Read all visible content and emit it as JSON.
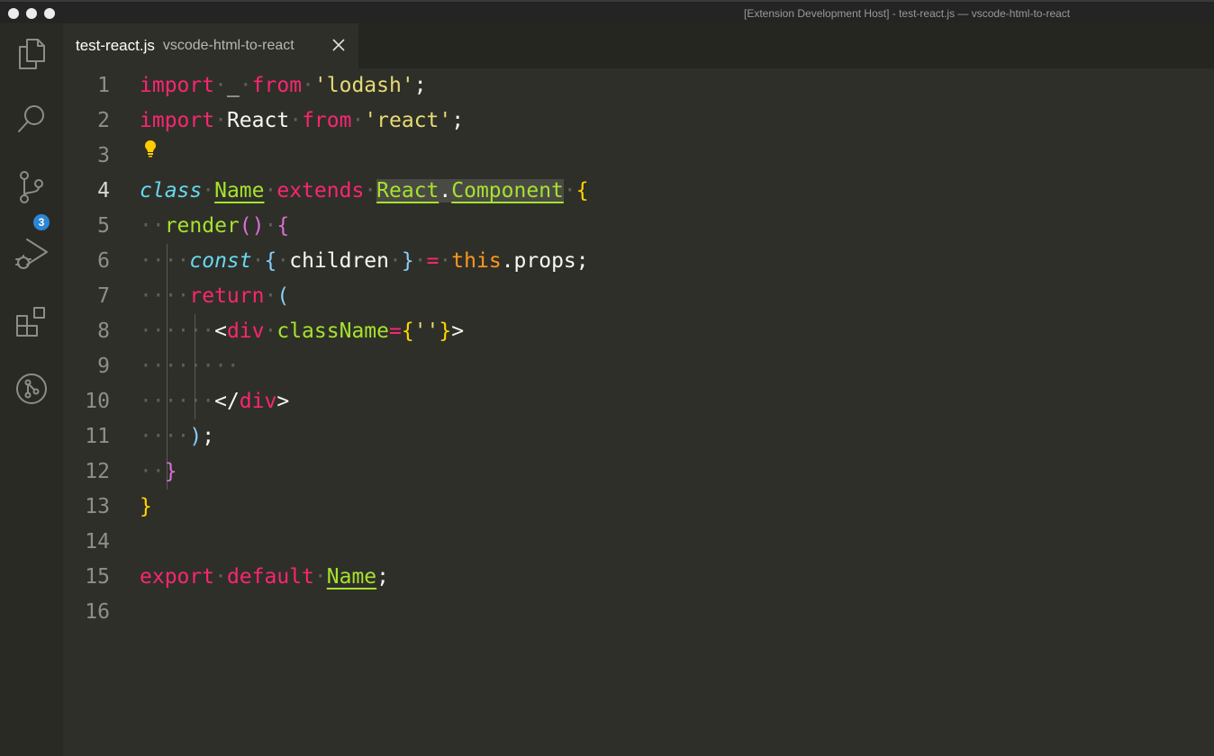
{
  "window": {
    "title": "[Extension Development Host] - test-react.js — vscode-html-to-react"
  },
  "activity_bar": {
    "items": [
      {
        "name": "explorer-icon"
      },
      {
        "name": "search-icon"
      },
      {
        "name": "source-control-icon",
        "badge": "3"
      },
      {
        "name": "run-debug-icon"
      },
      {
        "name": "extensions-icon"
      },
      {
        "name": "git-graph-icon"
      }
    ]
  },
  "tab": {
    "file_name": "test-react.js",
    "description": "vscode-html-to-react",
    "close_icon": "close-icon"
  },
  "editor": {
    "active_line": 4,
    "line_numbers": [
      "1",
      "2",
      "3",
      "4",
      "5",
      "6",
      "7",
      "8",
      "9",
      "10",
      "11",
      "12",
      "13",
      "14",
      "15",
      "16"
    ],
    "lines": [
      "import _ from 'lodash';",
      "import React from 'react';",
      "",
      "class Name extends React.Component {",
      "  render() {",
      "    const { children } = this.props;",
      "    return (",
      "      <div className={''}>",
      "        ",
      "      </div>",
      "    );",
      "  }",
      "}",
      "",
      "export default Name;",
      ""
    ]
  },
  "colors": {
    "keyword": "#f92672",
    "string": "#e6db74",
    "class": "#a6e22e",
    "storage": "#66d9ef",
    "this": "#fd971f",
    "bracket1": "#ffd700",
    "bracket2": "#da70d6",
    "bracket3": "#87cefa",
    "badge": "#2b86d6"
  }
}
